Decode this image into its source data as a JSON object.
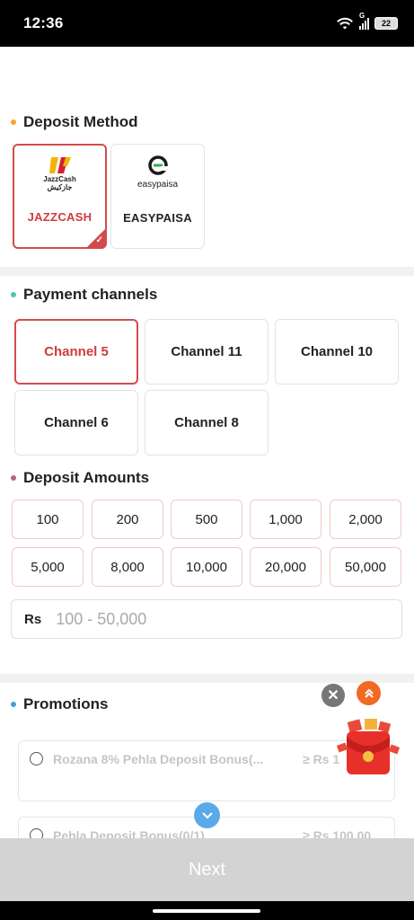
{
  "status_bar": {
    "time": "12:36",
    "network": "G",
    "battery": "22"
  },
  "deposit_method": {
    "title": "Deposit Method",
    "dot_color": "#f5a623",
    "options": [
      {
        "logo_top": "JazzCash",
        "logo_bottom": "جازکیش",
        "label": "JAZZCASH",
        "selected": true
      },
      {
        "logo_text": "easypaisa",
        "label": "EASYPAISA",
        "selected": false
      }
    ]
  },
  "payment_channels": {
    "title": "Payment channels",
    "dot_color": "#4fc3b0",
    "items": [
      "Channel 5",
      "Channel 11",
      "Channel 10",
      "Channel 6",
      "Channel 8"
    ],
    "selected": "Channel 5"
  },
  "deposit_amounts": {
    "title": "Deposit Amounts",
    "dot_color": "#b0687e",
    "items": [
      "100",
      "200",
      "500",
      "1,000",
      "2,000",
      "5,000",
      "8,000",
      "10,000",
      "20,000",
      "50,000"
    ],
    "currency": "Rs",
    "placeholder": "100 - 50,000"
  },
  "promotions": {
    "title": "Promotions",
    "dot_color": "#3aa0e0",
    "items": [
      {
        "label": "Rozana 8% Pehla Deposit Bonus(...",
        "amount": "≥ Rs 1"
      },
      {
        "label": "Pehla Deposit Bonus(0/1)",
        "amount": "≥ Rs 100.00"
      }
    ]
  },
  "accent_color": "#d24b4b",
  "next_label": "Next"
}
